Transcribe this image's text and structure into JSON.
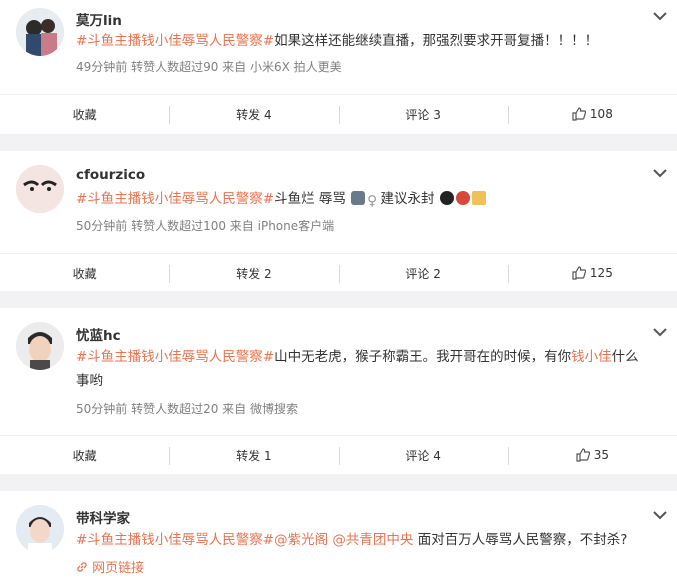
{
  "posts": [
    {
      "user": "莫万lin",
      "text": {
        "hashtag": "#斗鱼主播钱小佳辱骂人民警察#",
        "body": "如果这样还能继续直播，那强烈要求开哥复播！！！！"
      },
      "meta": "49分钟前 转赞人数超过90 来自 小米6X 拍人更美",
      "actions": {
        "collect": "收藏",
        "repost": "转发 4",
        "comment": "评论 3",
        "like": "108"
      }
    },
    {
      "user": "cfourzico",
      "text": {
        "hashtag": "#斗鱼主播钱小佳辱骂人民警察#",
        "body": "斗鱼烂 辱骂",
        "body2": "建议永封"
      },
      "meta": "50分钟前 转赞人数超过100 来自 iPhone客户端",
      "actions": {
        "collect": "收藏",
        "repost": "转发 2",
        "comment": "评论 2",
        "like": "125"
      }
    },
    {
      "user": "忧蓝hc",
      "text": {
        "hashtag": "#斗鱼主播钱小佳辱骂人民警察#",
        "body": "山中无老虎，猴子称霸王。我开哥在的时候，有你",
        "hl": "钱小佳",
        "body2": "什么",
        "line2": "事哟"
      },
      "meta": "50分钟前 转赞人数超过20 来自 微博搜索",
      "actions": {
        "collect": "收藏",
        "repost": "转发 1",
        "comment": "评论 4",
        "like": "35"
      }
    },
    {
      "user": "带科学家",
      "text": {
        "hashtag": "#斗鱼主播钱小佳辱骂人民警察#",
        "mention1": "@紫光阁",
        "mention2": "@共青团中央",
        "body": "面对百万人辱骂人民警察，不封杀?"
      },
      "link": "网页链接"
    }
  ]
}
